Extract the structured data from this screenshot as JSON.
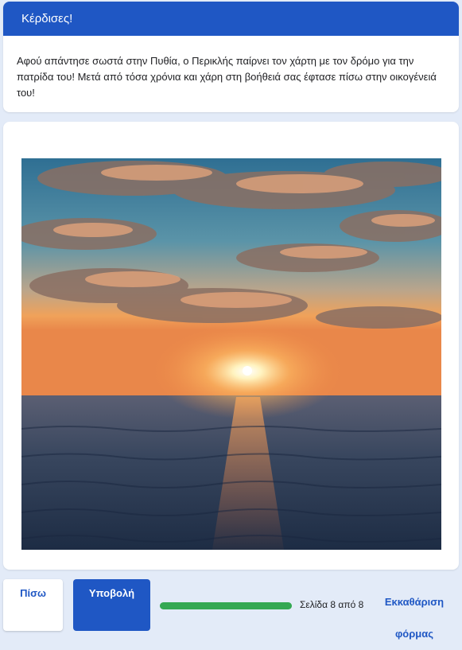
{
  "section": {
    "title": "Κέρδισες!",
    "description": "Αφού απάντησε σωστά στην Πυθία, ο Περικλής παίρνει τον χάρτη με τον δρόμο για την πατρίδα του! Μετά από τόσα χρόνια και χάρη στη βοήθειά σας έφτασε πίσω στην οικογένειά του!"
  },
  "footer": {
    "back_label": "Πίσω",
    "submit_label": "Υποβολή",
    "progress_fraction": 1.0,
    "page_text": "Σελίδα 8 από 8",
    "clear_label": "Εκκαθάριση φόρμας"
  },
  "colors": {
    "accent": "#1f57c4",
    "progress": "#34a853",
    "background": "#e3ebf8"
  }
}
